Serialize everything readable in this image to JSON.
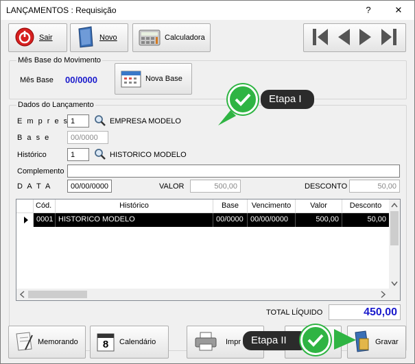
{
  "window": {
    "title": "LANÇAMENTOS : Requisição",
    "help_label": "?",
    "close_label": "✕"
  },
  "toolbar": {
    "sair": "Sair",
    "novo": "Novo",
    "calculadora": "Calculadora"
  },
  "nav": {
    "first": "first-icon",
    "prev": "prev-icon",
    "next": "next-icon",
    "last": "last-icon"
  },
  "mes_base_group": {
    "title": "Mês Base do Movimento",
    "label": "Mês Base",
    "value": "00/0000",
    "nova_base": "Nova Base"
  },
  "lancamento_group": {
    "title": "Dados do Lançamento",
    "empresa_label": "E m p r e s a",
    "empresa_code": "1",
    "empresa_name": "EMPRESA MODELO",
    "base_label": "B a s e",
    "base_value": "00/0000",
    "historico_label": "Histórico",
    "historico_code": "1",
    "historico_name": "HISTORICO MODELO",
    "complemento_label": "Complemento",
    "complemento_value": "",
    "data_label": "D A T A",
    "data_value": "00/00/0000",
    "valor_label": "VALOR",
    "valor_value": "500,00",
    "desconto_label": "DESCONTO",
    "desconto_value": "50,00"
  },
  "grid": {
    "columns": [
      "Cód.",
      "Histórico",
      "Base",
      "Vencimento",
      "Valor",
      "Desconto"
    ],
    "rows": [
      {
        "cod": "0001",
        "historico": "HISTORICO MODELO",
        "base": "00/0000",
        "vencimento": "00/00/0000",
        "valor": "500,00",
        "desconto": "50,00"
      }
    ]
  },
  "total": {
    "label": "TOTAL LÍQUIDO",
    "value": "450,00"
  },
  "bottom": {
    "memorando": "Memorando",
    "calendario": "Calendário",
    "imprimir": "Impr",
    "gravar": "Gravar",
    "calendar_day": "8"
  },
  "annotations": {
    "etapa1": "Etapa I",
    "etapa2": "Etapa II"
  },
  "colors": {
    "accent_blue": "#1a1acc",
    "check_green": "#2fb443",
    "badge_dark": "#2b2b2b"
  }
}
